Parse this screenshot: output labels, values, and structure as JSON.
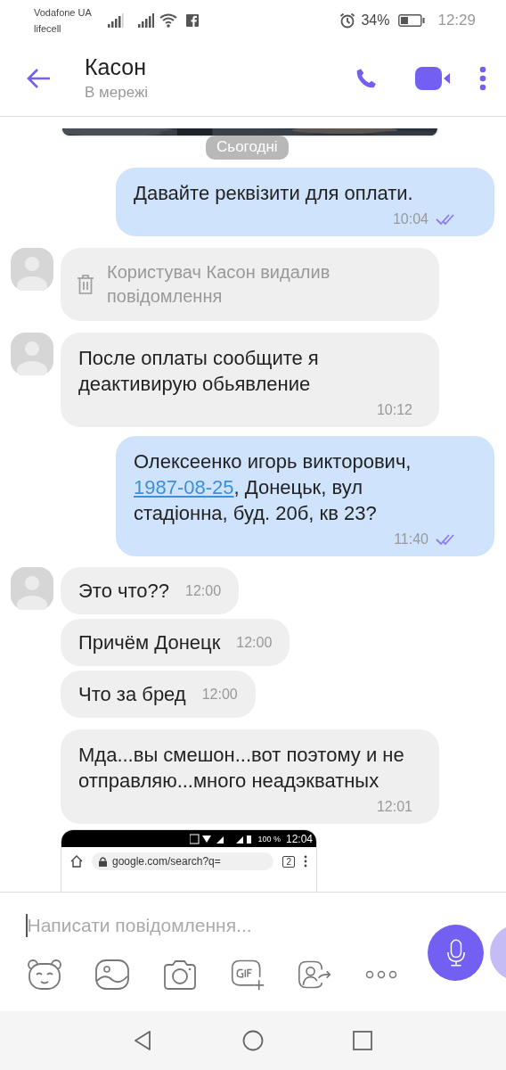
{
  "status_bar": {
    "carrier_1": "Vodafone UA",
    "carrier_2": "lifecell",
    "battery_percent": "34%",
    "time": "12:29"
  },
  "header": {
    "title": "Касон",
    "subtitle": "В мережі"
  },
  "date_chip": "Сьогодні",
  "messages": [
    {
      "kind": "outgoing",
      "parts": [
        {
          "kind": "text",
          "text": "Давайте реквізити для оплати."
        }
      ],
      "time": "10:04",
      "read": true
    },
    {
      "kind": "deleted",
      "avatar": true,
      "text": "Користувач Касон видалив повідомлення"
    },
    {
      "kind": "incoming",
      "avatar": true,
      "text": "После оплаты сообщите я деактивирую обьявление",
      "time": "10:12"
    },
    {
      "kind": "outgoing",
      "parts": [
        {
          "kind": "text",
          "text": "Олексеенко игорь викторович, "
        },
        {
          "kind": "link",
          "text": "1987-08-25"
        },
        {
          "kind": "text",
          "text": ", Донецьк, вул стадіонна, буд. 20б, кв 23?"
        }
      ],
      "time": "11:40",
      "read": true
    },
    {
      "kind": "short",
      "avatar": true,
      "text": "Это что??",
      "time": "12:00"
    },
    {
      "kind": "short",
      "avatar": false,
      "text": "Причём Донецк",
      "time": "12:00"
    },
    {
      "kind": "short",
      "avatar": false,
      "text": "Что за бред",
      "time": "12:00"
    },
    {
      "kind": "incoming",
      "avatar": false,
      "text": "Мда...вы смешон...вот поэтому и не отправляю...много неадэкватных",
      "time": "12:01"
    },
    {
      "kind": "screenshot",
      "status_time": "12:04",
      "battery": "100 %",
      "url": "google.com/search?q=",
      "tab_count": "2"
    }
  ],
  "composer": {
    "placeholder": "Написати повідомлення..."
  }
}
